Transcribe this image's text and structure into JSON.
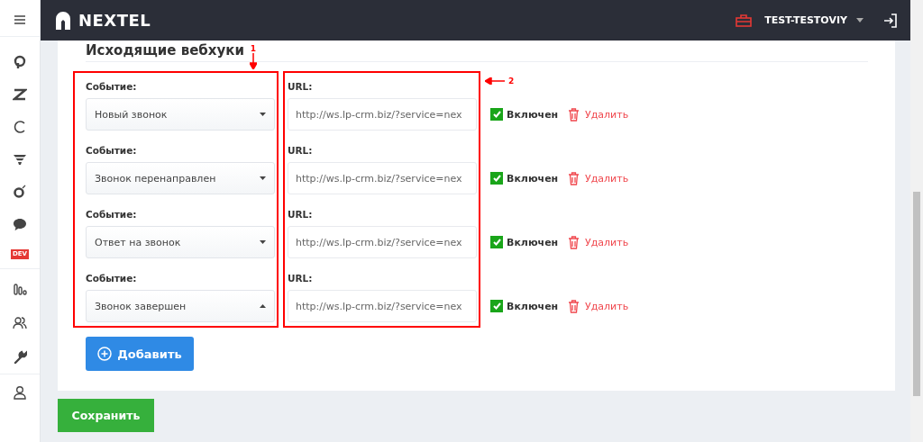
{
  "header": {
    "logo": "NEXTEL",
    "user": "TEST-TESTOVIY"
  },
  "sidebar": {
    "badge": "DEV"
  },
  "section": {
    "title": "Исходящие вебхуки"
  },
  "webhooks": [
    {
      "event_label": "Событие:",
      "event": "Новый звонок",
      "open": false,
      "url_label": "URL:",
      "url": "http://ws.lp-crm.biz/?service=nex",
      "enabled": true,
      "enabled_label": "Включен",
      "delete": "Удалить"
    },
    {
      "event_label": "Событие:",
      "event": "Звонок перенаправлен",
      "open": false,
      "url_label": "URL:",
      "url": "http://ws.lp-crm.biz/?service=nex",
      "enabled": true,
      "enabled_label": "Включен",
      "delete": "Удалить"
    },
    {
      "event_label": "Событие:",
      "event": "Ответ на звонок",
      "open": false,
      "url_label": "URL:",
      "url": "http://ws.lp-crm.biz/?service=nex",
      "enabled": true,
      "enabled_label": "Включен",
      "delete": "Удалить"
    },
    {
      "event_label": "Событие:",
      "event": "Звонок завершен",
      "open": true,
      "url_label": "URL:",
      "url": "http://ws.lp-crm.biz/?service=nex",
      "enabled": true,
      "enabled_label": "Включен",
      "delete": "Удалить"
    }
  ],
  "annotations": [
    "1",
    "2"
  ],
  "add_button": "Добавить",
  "save_button": "Сохранить"
}
